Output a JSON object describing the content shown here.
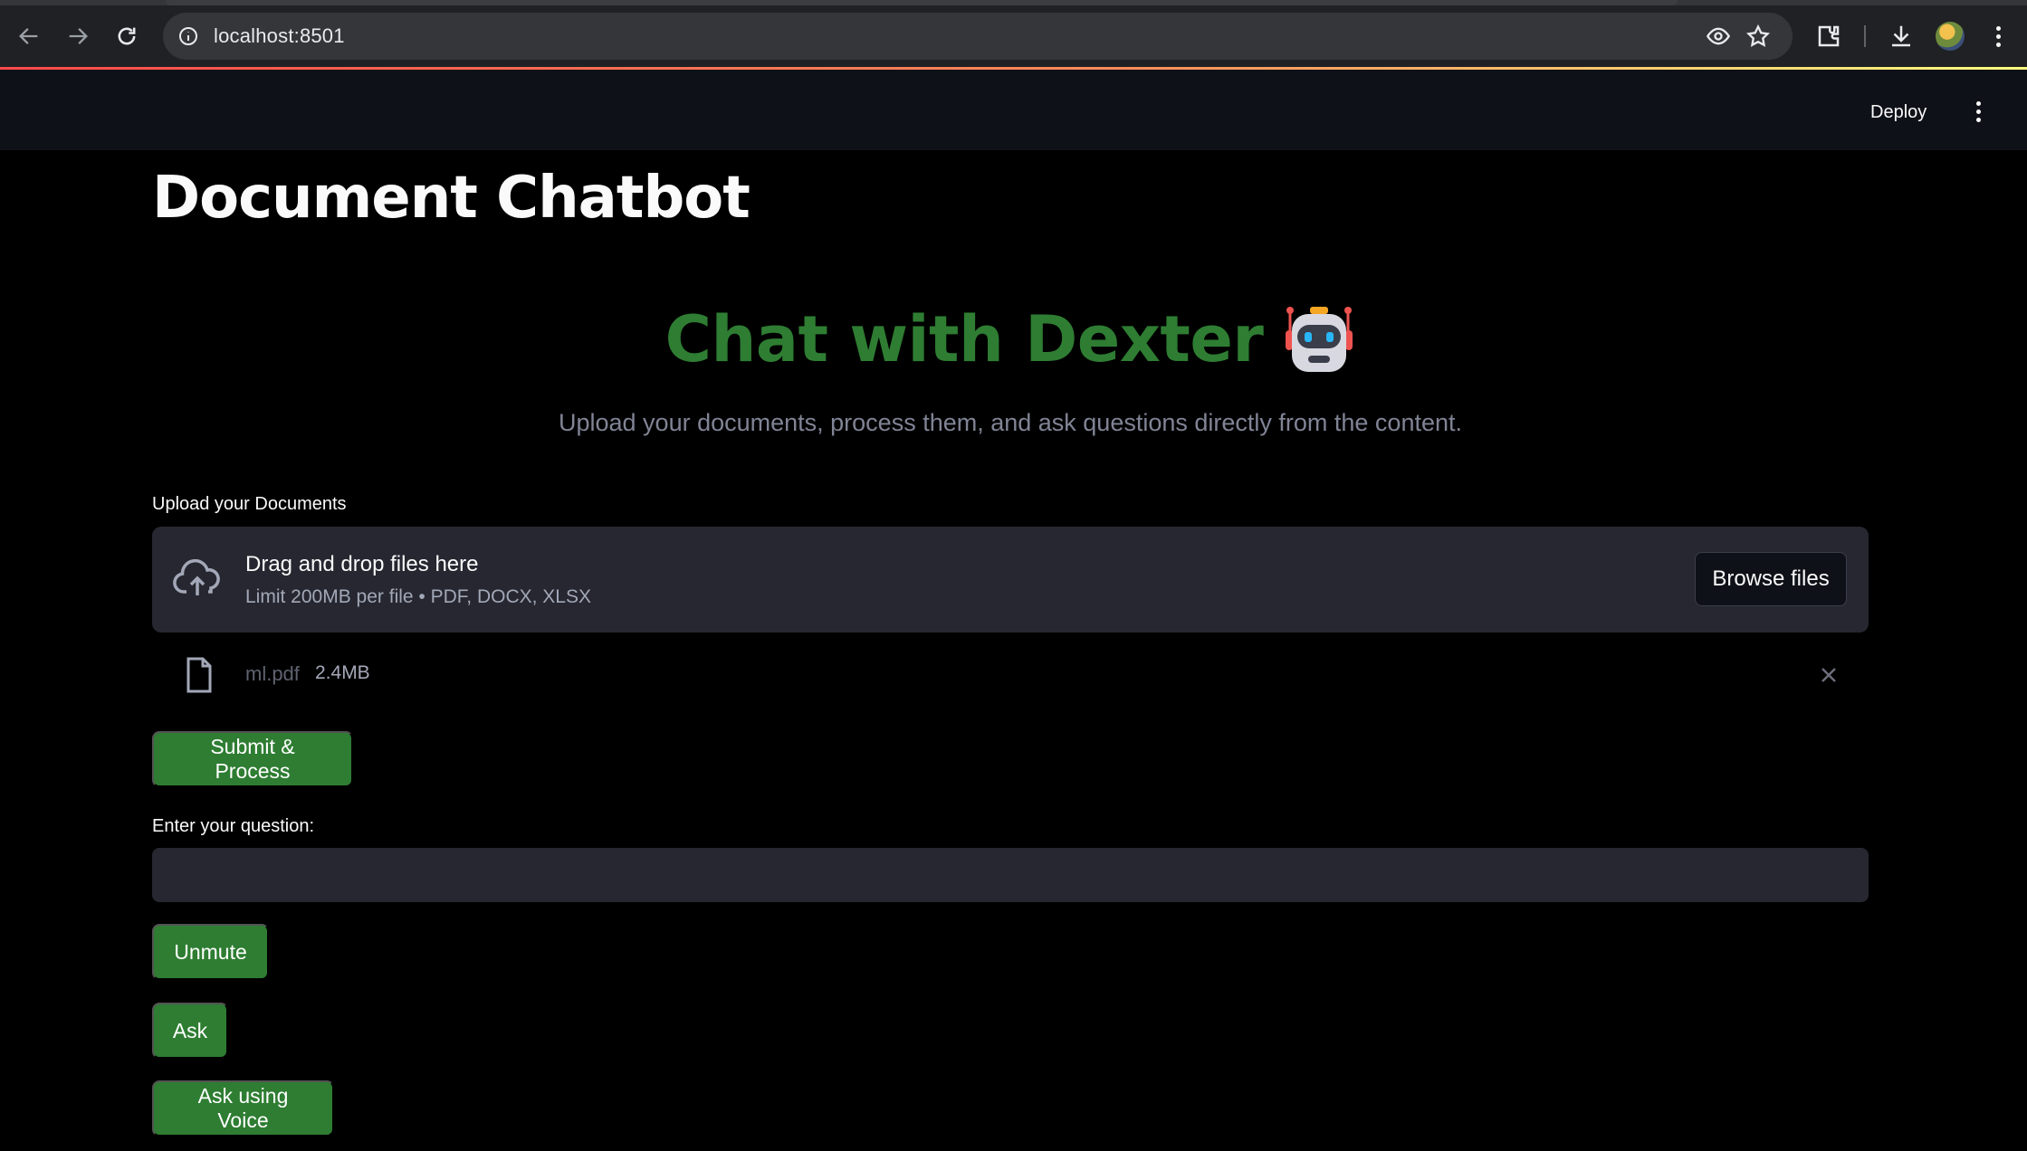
{
  "browser": {
    "url": "localhost:8501"
  },
  "header": {
    "deploy_label": "Deploy"
  },
  "main": {
    "title": "Document Chatbot",
    "hero_title": "Chat with Dexter",
    "hero_subtitle": "Upload your documents, process them, and ask questions directly from the content."
  },
  "uploader": {
    "label": "Upload your Documents",
    "drop_text": "Drag and drop files here",
    "limit_text": "Limit 200MB per file • PDF, DOCX, XLSX",
    "browse_label": "Browse files",
    "file": {
      "name": "ml.pdf",
      "size": "2.4MB"
    }
  },
  "actions": {
    "submit_label": "Submit & Process",
    "question_label": "Enter your question:",
    "question_value": "",
    "unmute_label": "Unmute",
    "ask_label": "Ask",
    "ask_voice_label": "Ask using Voice"
  },
  "colors": {
    "accent_green": "#2e7d32",
    "background": "#000000",
    "header_bg": "#0e1117",
    "widget_bg": "#262730"
  }
}
